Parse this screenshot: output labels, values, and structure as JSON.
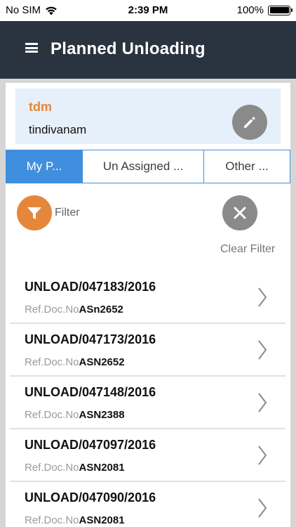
{
  "status_bar": {
    "carrier": "No SIM",
    "time": "2:39 PM",
    "battery": "100%"
  },
  "header": {
    "title": "Planned Unloading"
  },
  "user": {
    "name": "tdm",
    "location": "tindivanam"
  },
  "tabs": [
    {
      "label": "My P...",
      "active": true
    },
    {
      "label": "Un Assigned ...",
      "active": false
    },
    {
      "label": "Other ...",
      "active": false
    }
  ],
  "filter": {
    "label": "Filter",
    "clear_label": "Clear Filter"
  },
  "list": {
    "ref_label": "Ref.Doc.No",
    "items": [
      {
        "title": "UNLOAD/047183/2016",
        "ref": "ASn2652"
      },
      {
        "title": "UNLOAD/047173/2016",
        "ref": "ASN2652"
      },
      {
        "title": "UNLOAD/047148/2016",
        "ref": "ASN2388"
      },
      {
        "title": "UNLOAD/047097/2016",
        "ref": "ASN2081"
      },
      {
        "title": "UNLOAD/047090/2016",
        "ref": "ASN2081"
      }
    ]
  },
  "colors": {
    "header_bg": "#2a3340",
    "accent_orange": "#e4873a",
    "tab_blue": "#3f8fde",
    "icon_grey": "#8a8a8a"
  }
}
